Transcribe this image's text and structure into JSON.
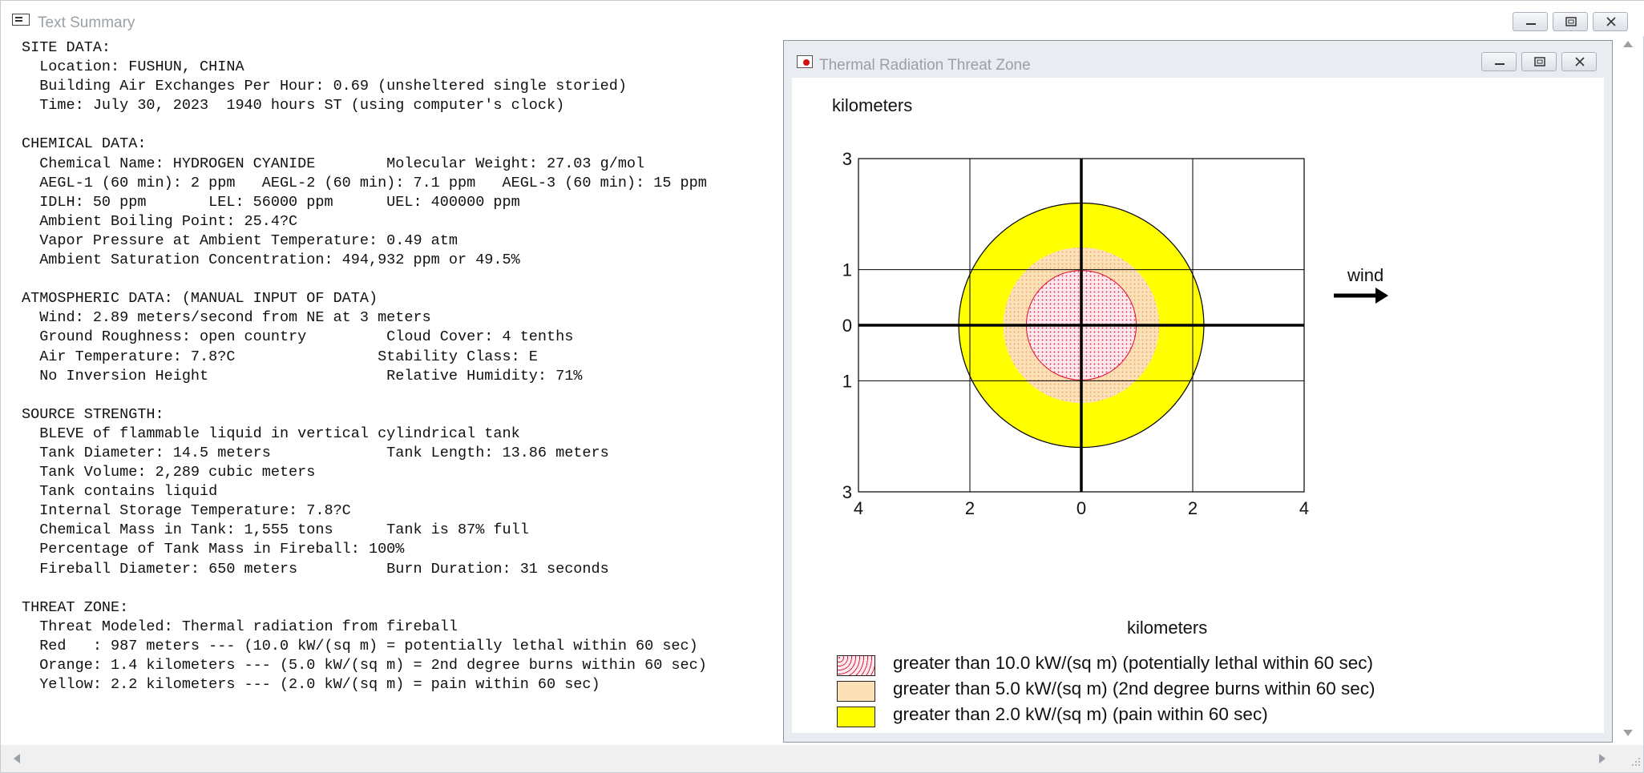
{
  "outer_window": {
    "title": "Text Summary"
  },
  "summary_lines": [
    "SITE DATA:",
    "  Location: FUSHUN, CHINA",
    "  Building Air Exchanges Per Hour: 0.69 (unsheltered single storied)",
    "  Time: July 30, 2023  1940 hours ST (using computer's clock)",
    "",
    "CHEMICAL DATA:",
    "  Chemical Name: HYDROGEN CYANIDE        Molecular Weight: 27.03 g/mol",
    "  AEGL-1 (60 min): 2 ppm   AEGL-2 (60 min): 7.1 ppm   AEGL-3 (60 min): 15 ppm",
    "  IDLH: 50 ppm       LEL: 56000 ppm      UEL: 400000 ppm",
    "  Ambient Boiling Point: 25.4?C",
    "  Vapor Pressure at Ambient Temperature: 0.49 atm",
    "  Ambient Saturation Concentration: 494,932 ppm or 49.5%",
    "",
    "ATMOSPHERIC DATA: (MANUAL INPUT OF DATA)",
    "  Wind: 2.89 meters/second from NE at 3 meters",
    "  Ground Roughness: open country         Cloud Cover: 4 tenths",
    "  Air Temperature: 7.8?C                Stability Class: E",
    "  No Inversion Height                    Relative Humidity: 71%",
    "",
    "SOURCE STRENGTH:",
    "  BLEVE of flammable liquid in vertical cylindrical tank",
    "  Tank Diameter: 14.5 meters             Tank Length: 13.86 meters",
    "  Tank Volume: 2,289 cubic meters",
    "  Tank contains liquid",
    "  Internal Storage Temperature: 7.8?C",
    "  Chemical Mass in Tank: 1,555 tons      Tank is 87% full",
    "  Percentage of Tank Mass in Fireball: 100%",
    "  Fireball Diameter: 650 meters          Burn Duration: 31 seconds",
    "",
    "THREAT ZONE:",
    "  Threat Modeled: Thermal radiation from fireball",
    "  Red   : 987 meters --- (10.0 kW/(sq m) = potentially lethal within 60 sec)",
    "  Orange: 1.4 kilometers --- (5.0 kW/(sq m) = 2nd degree burns within 60 sec)",
    "  Yellow: 2.2 kilometers --- (2.0 kW/(sq m) = pain within 60 sec)"
  ],
  "inner_window": {
    "title": "Thermal Radiation Threat Zone"
  },
  "chart_data": {
    "type": "threat-zone-plot",
    "ylabel": "kilometers",
    "xlabel": "kilometers",
    "xlim": [
      -4,
      4
    ],
    "ylim": [
      -3,
      3
    ],
    "x_tick_labels": [
      "4",
      "2",
      "0",
      "2",
      "4"
    ],
    "x_tick_values": [
      -4,
      -2,
      0,
      2,
      4
    ],
    "y_tick_labels": [
      "3",
      "1",
      "0",
      "1",
      "3"
    ],
    "y_tick_values": [
      3,
      1,
      0,
      -1,
      -3
    ],
    "wind_label": "wind",
    "wind_direction": "right",
    "zones": [
      {
        "name": "Yellow",
        "radius_km": 2.2,
        "color": "#ffff00",
        "pattern": "solid"
      },
      {
        "name": "Orange",
        "radius_km": 1.4,
        "color": "#fce0b8",
        "pattern": "dots-orange"
      },
      {
        "name": "Red",
        "radius_km": 0.987,
        "color": "#fde4ea",
        "pattern": "dots-red"
      }
    ],
    "legend": [
      {
        "label": "greater than 10.0 kW/(sq m) (potentially lethal within 60 sec)",
        "swatch": "red"
      },
      {
        "label": "greater than 5.0 kW/(sq m) (2nd degree burns within 60 sec)",
        "swatch": "orange"
      },
      {
        "label": "greater than 2.0 kW/(sq m) (pain within 60 sec)",
        "swatch": "yellow"
      }
    ]
  },
  "colors": {
    "yellow_zone": "#ffff00",
    "orange_zone_bg": "#fce0b8",
    "orange_zone_dot": "#e8a060",
    "red_zone_bg": "#fde4ea",
    "red_zone_dot": "#e01030",
    "red_zone_stroke": "#e01030"
  }
}
